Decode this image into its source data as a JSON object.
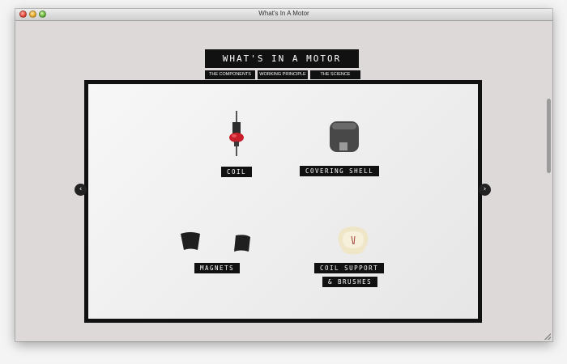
{
  "window": {
    "title": "What's In A Motor"
  },
  "site": {
    "logo": "WHAT'S IN A MOTOR"
  },
  "nav": {
    "items": [
      {
        "label": "THE COMPONENTS"
      },
      {
        "label": "WORKING PRINCIPLE"
      },
      {
        "label": "THE SCIENCE"
      }
    ]
  },
  "components": {
    "coil": "COIL",
    "covering_shell": "COVERING SHELL",
    "magnets": "MAGNETS",
    "coil_support_line1": "COIL SUPPORT",
    "coil_support_line2": "& BRUSHES"
  },
  "carousel": {
    "prev_icon": "chevron-left-icon",
    "next_icon": "chevron-right-icon",
    "prev_glyph": "‹",
    "next_glyph": "›"
  },
  "colors": {
    "label_bg": "#111111",
    "page_bg": "#ddd9d9",
    "coil_red": "#c8202a"
  }
}
